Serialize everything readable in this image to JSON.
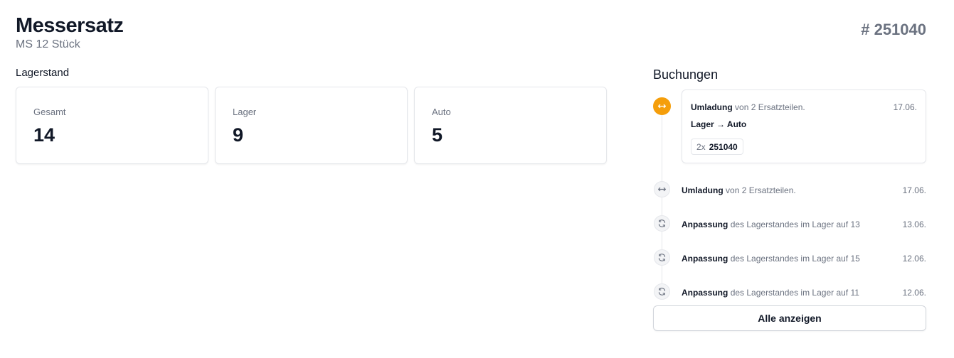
{
  "header": {
    "title": "Messersatz",
    "subtitle": "MS 12 Stück",
    "item_number": "# 251040"
  },
  "stock": {
    "section_title": "Lagerstand",
    "cards": [
      {
        "label": "Gesamt",
        "value": "14"
      },
      {
        "label": "Lager",
        "value": "9"
      },
      {
        "label": "Auto",
        "value": "5"
      }
    ]
  },
  "bookings": {
    "title": "Buchungen",
    "featured": {
      "icon": "transfer-icon",
      "type": "Umladung",
      "text": "von 2 Ersatzteilen.",
      "date": "17.06.",
      "route": "Lager → Auto",
      "qty": "2x",
      "part": "251040",
      "accent_color": "#f59e0b"
    },
    "items": [
      {
        "icon": "transfer-icon",
        "type": "Umladung",
        "text": "von 2 Ersatzteilen.",
        "date": "17.06."
      },
      {
        "icon": "refresh-icon",
        "type": "Anpassung",
        "text": "des Lagerstandes im Lager auf 13",
        "date": "13.06."
      },
      {
        "icon": "refresh-icon",
        "type": "Anpassung",
        "text": "des Lagerstandes im Lager auf 15",
        "date": "12.06."
      },
      {
        "icon": "refresh-icon",
        "type": "Anpassung",
        "text": "des Lagerstandes im Lager auf 11",
        "date": "12.06."
      }
    ],
    "show_all_label": "Alle anzeigen"
  }
}
